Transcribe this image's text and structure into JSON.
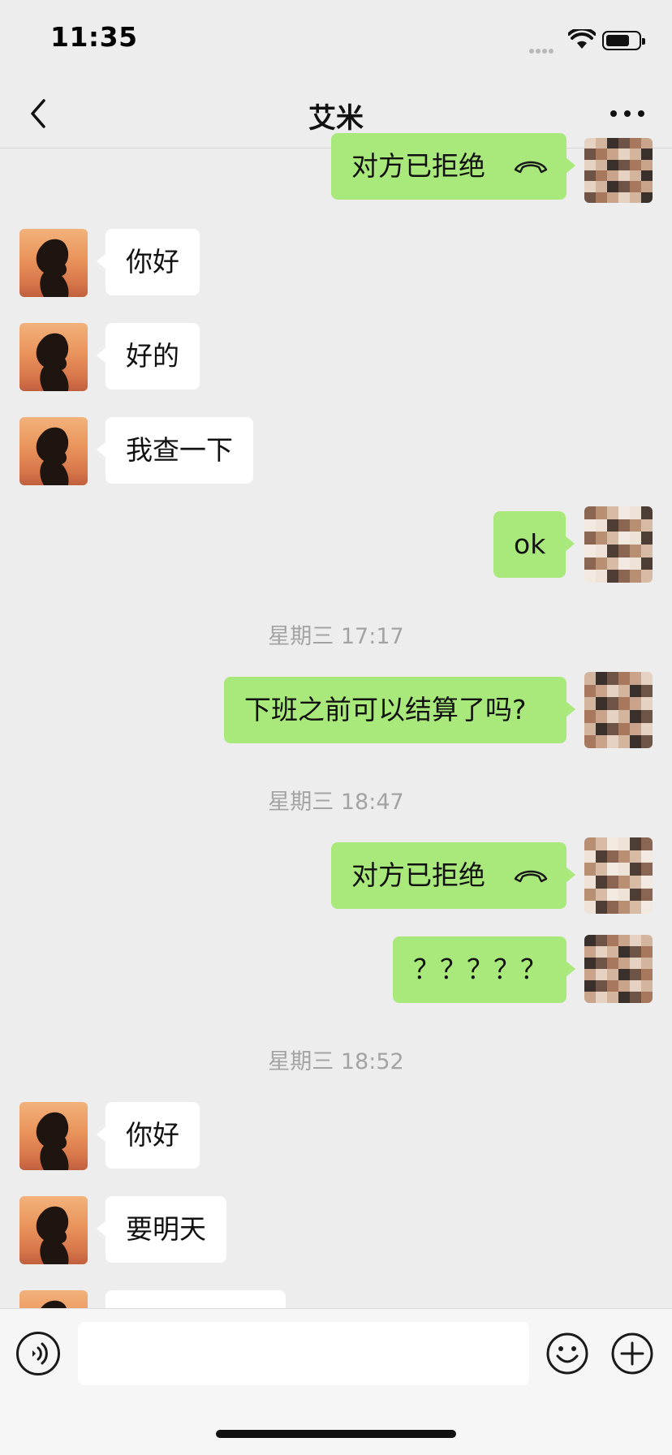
{
  "status_bar": {
    "time": "11:35"
  },
  "header": {
    "title": "艾米"
  },
  "messages": [
    {
      "side": "out",
      "text": "对方已拒绝",
      "call_icon": "phone-hangup-icon"
    },
    {
      "side": "in",
      "text": "你好"
    },
    {
      "side": "in",
      "text": "好的"
    },
    {
      "side": "in",
      "text": "我查一下"
    },
    {
      "side": "out",
      "text": "ok"
    },
    {
      "timestamp": "星期三 17:17"
    },
    {
      "side": "out",
      "text": "下班之前可以结算了吗?"
    },
    {
      "timestamp": "星期三 18:47"
    },
    {
      "side": "out",
      "text": "对方已拒绝",
      "call_icon": "phone-hangup-icon"
    },
    {
      "side": "out",
      "text": "？？？？？"
    },
    {
      "timestamp": "星期三 18:52"
    },
    {
      "side": "in",
      "text": "你好"
    },
    {
      "side": "in",
      "text": "要明天"
    },
    {
      "side": "in",
      "text": ""
    }
  ],
  "input": {
    "value": "",
    "placeholder": ""
  },
  "colors": {
    "background": "#ededed",
    "outgoing_bubble": "#a9e87a",
    "incoming_bubble": "#ffffff"
  }
}
